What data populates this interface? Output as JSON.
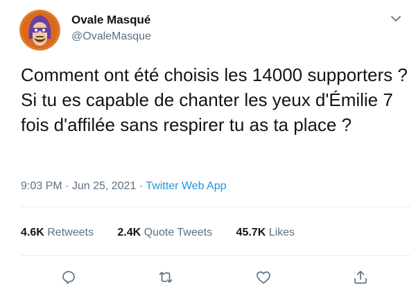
{
  "author": {
    "display_name": "Ovale Masqué",
    "handle": "@OvaleMasque"
  },
  "tweet": {
    "text": "Comment ont été choisis les 14000 supporters ? Si tu es capable de chanter les yeux d'Émilie 7 fois d'affilée sans respirer tu as ta place ?"
  },
  "meta": {
    "time": "9:03 PM",
    "separator": "·",
    "date": "Jun 25, 2021",
    "source": "Twitter Web App"
  },
  "stats": [
    {
      "count": "4.6K",
      "label": "Retweets"
    },
    {
      "count": "2.4K",
      "label": "Quote Tweets"
    },
    {
      "count": "45.7K",
      "label": "Likes"
    }
  ],
  "colors": {
    "text": "#0f1419",
    "secondary": "#5b7083",
    "link": "#1b95e0",
    "divider": "#e6ecf0"
  },
  "icons": {
    "caret": "chevron-down-icon",
    "reply": "reply-icon",
    "retweet": "retweet-icon",
    "like": "heart-icon",
    "share": "share-icon"
  }
}
